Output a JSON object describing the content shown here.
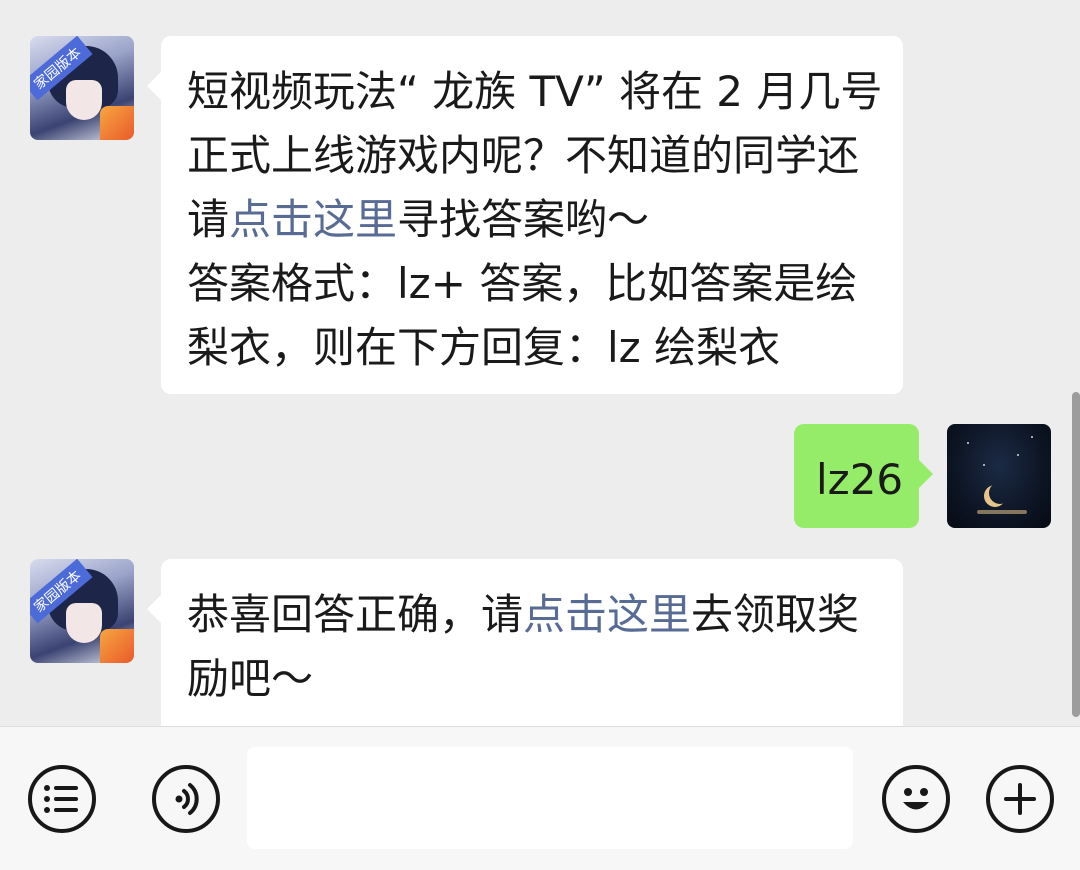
{
  "messages": [
    {
      "sender": "bot",
      "lines": [
        {
          "text": "短视频玩法“ 龙族 TV” 将在 2 月几号"
        },
        {
          "text": "正式上线游戏内呢？不知道的同学还"
        },
        {
          "pre": "请",
          "link": "点击这里",
          "post": "寻找答案哟～"
        },
        {
          "text": "答案格式：lz+ 答案，比如答案是绘"
        },
        {
          "text": "梨衣，则在下方回复：lz 绘梨衣"
        }
      ]
    },
    {
      "sender": "me",
      "text": "lz26"
    },
    {
      "sender": "bot",
      "lines": [
        {
          "pre": "恭喜回答正确，请",
          "link": "点击这里",
          "post": "去领取奖"
        },
        {
          "text": "励吧～"
        }
      ]
    }
  ],
  "avatars": {
    "bot_badge": "家园版本"
  },
  "input": {
    "value": "",
    "placeholder": ""
  },
  "icons": {
    "left1": "list-icon",
    "left2": "voice-icon",
    "right1": "emoji-icon",
    "right2": "plus-icon"
  },
  "colors": {
    "background": "#ededed",
    "bubble_other": "#ffffff",
    "bubble_self": "#95ec69",
    "link": "#576b95"
  }
}
